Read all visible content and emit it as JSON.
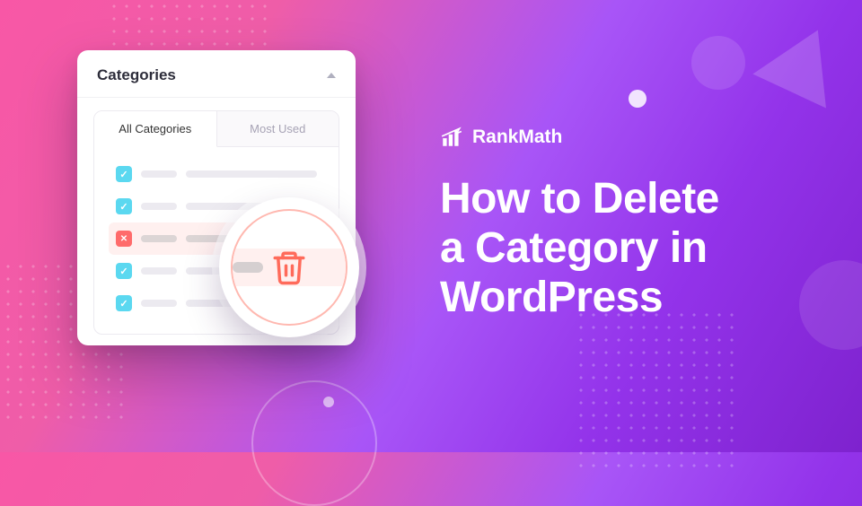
{
  "panel": {
    "title": "Categories",
    "tabs": {
      "active": "All Categories",
      "inactive": "Most Used"
    }
  },
  "brand": {
    "name": "RankMath"
  },
  "headline": {
    "line1": "How to Delete",
    "line2": "a Category in",
    "line3": "WordPress"
  },
  "icons": {
    "trash": "trash-icon",
    "caret": "caret-up",
    "logo": "rankmath-logo"
  }
}
